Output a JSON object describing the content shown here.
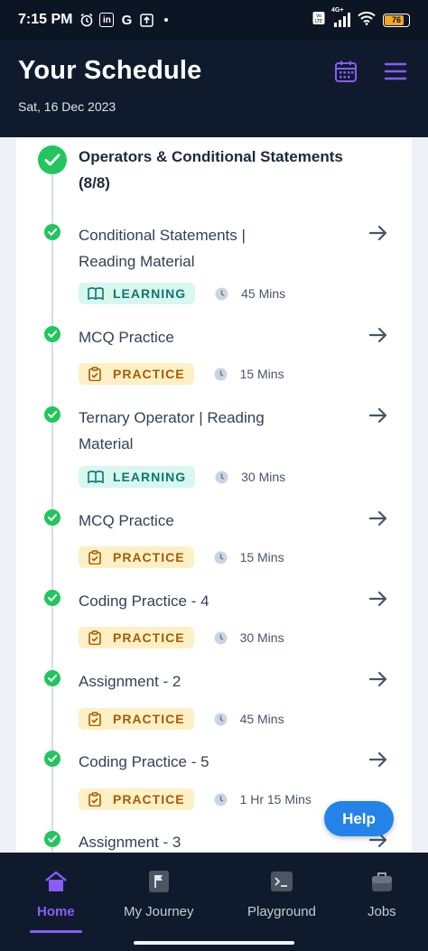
{
  "status_bar": {
    "time": "7:15 PM",
    "icon_g": "G",
    "battery_level": "76",
    "network": "4G+"
  },
  "header": {
    "title": "Your Schedule",
    "date": "Sat, 16 Dec 2023"
  },
  "group": {
    "title": "Operators & Conditional Statements (8/8)"
  },
  "items": [
    {
      "title": "Conditional Statements | Reading Material",
      "badge": "LEARNING",
      "type": "learning",
      "duration": "45 Mins"
    },
    {
      "title": "MCQ Practice",
      "badge": "PRACTICE",
      "type": "practice",
      "duration": "15 Mins"
    },
    {
      "title": "Ternary Operator | Reading Material",
      "badge": "LEARNING",
      "type": "learning",
      "duration": "30 Mins"
    },
    {
      "title": "MCQ Practice",
      "badge": "PRACTICE",
      "type": "practice",
      "duration": "15 Mins"
    },
    {
      "title": "Coding Practice - 4",
      "badge": "PRACTICE",
      "type": "practice",
      "duration": "30 Mins"
    },
    {
      "title": "Assignment - 2",
      "badge": "PRACTICE",
      "type": "practice",
      "duration": "45 Mins"
    },
    {
      "title": "Coding Practice - 5",
      "badge": "PRACTICE",
      "type": "practice",
      "duration": "1 Hr 15 Mins"
    },
    {
      "title": "Assignment - 3",
      "badge": "",
      "type": "practice",
      "duration": ""
    }
  ],
  "help_button": {
    "label": "Help"
  },
  "bottom_nav": [
    {
      "label": "Home",
      "icon": "home-icon",
      "active": true
    },
    {
      "label": "My Journey",
      "icon": "flag-icon",
      "active": false
    },
    {
      "label": "Playground",
      "icon": "terminal-icon",
      "active": false
    },
    {
      "label": "Jobs",
      "icon": "briefcase-icon",
      "active": false
    }
  ],
  "colors": {
    "accent": "#8b5cf6",
    "success": "#22c55e",
    "help": "#2383e8",
    "dark_bg": "#0f1b2d"
  }
}
